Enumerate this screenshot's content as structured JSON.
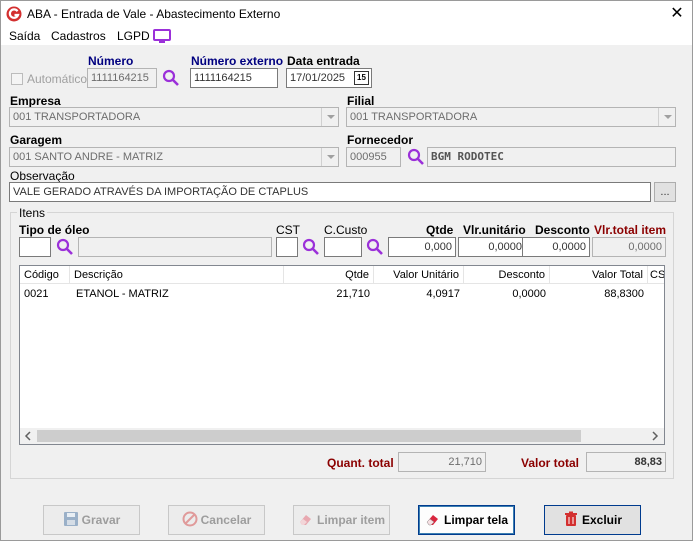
{
  "window": {
    "title": "ABA - Entrada de Vale - Abastecimento Externo",
    "close_glyph": "✕"
  },
  "menu": [
    "Saída",
    "Cadastros",
    "LGPD"
  ],
  "header": {
    "automatico_label": "Automático",
    "numero_label": "Número",
    "numero_value": "1111164215",
    "numero_externo_label": "Número externo",
    "numero_externo_value": "1111164215",
    "data_entrada_label": "Data entrada",
    "data_entrada_value": "17/01/2025",
    "calendar_glyph": "15"
  },
  "empresa": {
    "label": "Empresa",
    "value": "001 TRANSPORTADORA"
  },
  "filial": {
    "label": "Filial",
    "value": "001 TRANSPORTADORA"
  },
  "garagem": {
    "label": "Garagem",
    "value": "001 SANTO ANDRE - MATRIZ"
  },
  "fornecedor": {
    "label": "Fornecedor",
    "code": "000955",
    "name": "BGM RODOTEC"
  },
  "observacao": {
    "label": "Observação",
    "value": "VALE GERADO ATRAVÉS DA IMPORTAÇÃO DE CTAPLUS",
    "button": "..."
  },
  "itens": {
    "group_label": "Itens",
    "tipo_oleo_label": "Tipo de óleo",
    "cst_label": "CST",
    "ccusto_label": "C.Custo",
    "qtde_label": "Qtde",
    "vlr_unitario_label": "Vlr.unitário",
    "desconto_label": "Desconto",
    "vlr_total_label": "Vlr.total item",
    "qtde_value": "0,000",
    "vlr_unitario_value": "0,0000",
    "desconto_value": "0,0000",
    "vlr_total_value": "0,0000"
  },
  "grid": {
    "columns": [
      "Código",
      "Descrição",
      "Qtde",
      "Valor Unitário",
      "Desconto",
      "Valor Total",
      "CS"
    ],
    "rows": [
      [
        "0021",
        "ETANOL - MATRIZ",
        "21,710",
        "4,0917",
        "0,0000",
        "88,8300"
      ]
    ]
  },
  "totals": {
    "quant_label": "Quant. total",
    "quant_value": "21,710",
    "valor_label": "Valor total",
    "valor_value": "88,83"
  },
  "buttons": {
    "gravar": "Gravar",
    "cancelar": "Cancelar",
    "limpar_item": "Limpar item",
    "limpar_tela": "Limpar tela",
    "excluir": "Excluir"
  },
  "colors": {
    "navy_label": "#000080",
    "dark_red_label": "#8b0000",
    "search_icon": "#9b30d9",
    "app_icon": "#d32f2f"
  }
}
